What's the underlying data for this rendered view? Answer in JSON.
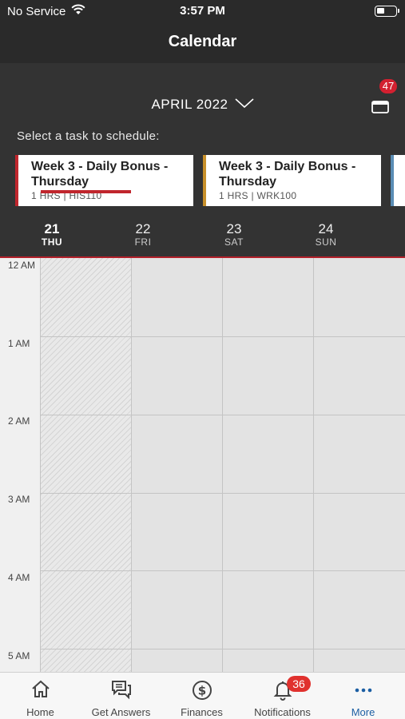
{
  "status_bar": {
    "carrier": "No Service",
    "time": "3:57 PM",
    "icons": [
      "wifi-icon",
      "battery-icon"
    ]
  },
  "header": {
    "title": "Calendar"
  },
  "controls": {
    "month": "APRIL 2022",
    "calendar_badge": "47",
    "select_label": "Select a task to schedule:"
  },
  "task_cards": [
    {
      "title": "Week 3 - Daily Bonus - Thursday",
      "meta": "1 HRS | HIS110",
      "accent": "#c0262d"
    },
    {
      "title": "Week 3 - Daily Bonus - Thursday",
      "meta": "1 HRS | WRK100",
      "accent": "#c8902a"
    },
    {
      "title": "",
      "meta": "",
      "accent": "#5a8db5"
    }
  ],
  "days": [
    {
      "num": "21",
      "name": "THU",
      "active": true
    },
    {
      "num": "22",
      "name": "FRI",
      "active": false
    },
    {
      "num": "23",
      "name": "SAT",
      "active": false
    },
    {
      "num": "24",
      "name": "SUN",
      "active": false
    }
  ],
  "time_labels": [
    "12 AM",
    "1 AM",
    "2 AM",
    "3 AM",
    "4 AM",
    "5 AM"
  ],
  "tabs": [
    {
      "label": "Home",
      "icon": "home-icon",
      "active": false
    },
    {
      "label": "Get Answers",
      "icon": "chat-icon",
      "active": false
    },
    {
      "label": "Finances",
      "icon": "dollar-icon",
      "active": false
    },
    {
      "label": "Notifications",
      "icon": "bell-icon",
      "active": false,
      "badge": "36"
    },
    {
      "label": "More",
      "icon": "more-icon",
      "active": true
    }
  ],
  "colors": {
    "accent_red": "#c0262d",
    "active_tab_blue": "#1c5fa3",
    "badge_red": "#e0312e"
  }
}
